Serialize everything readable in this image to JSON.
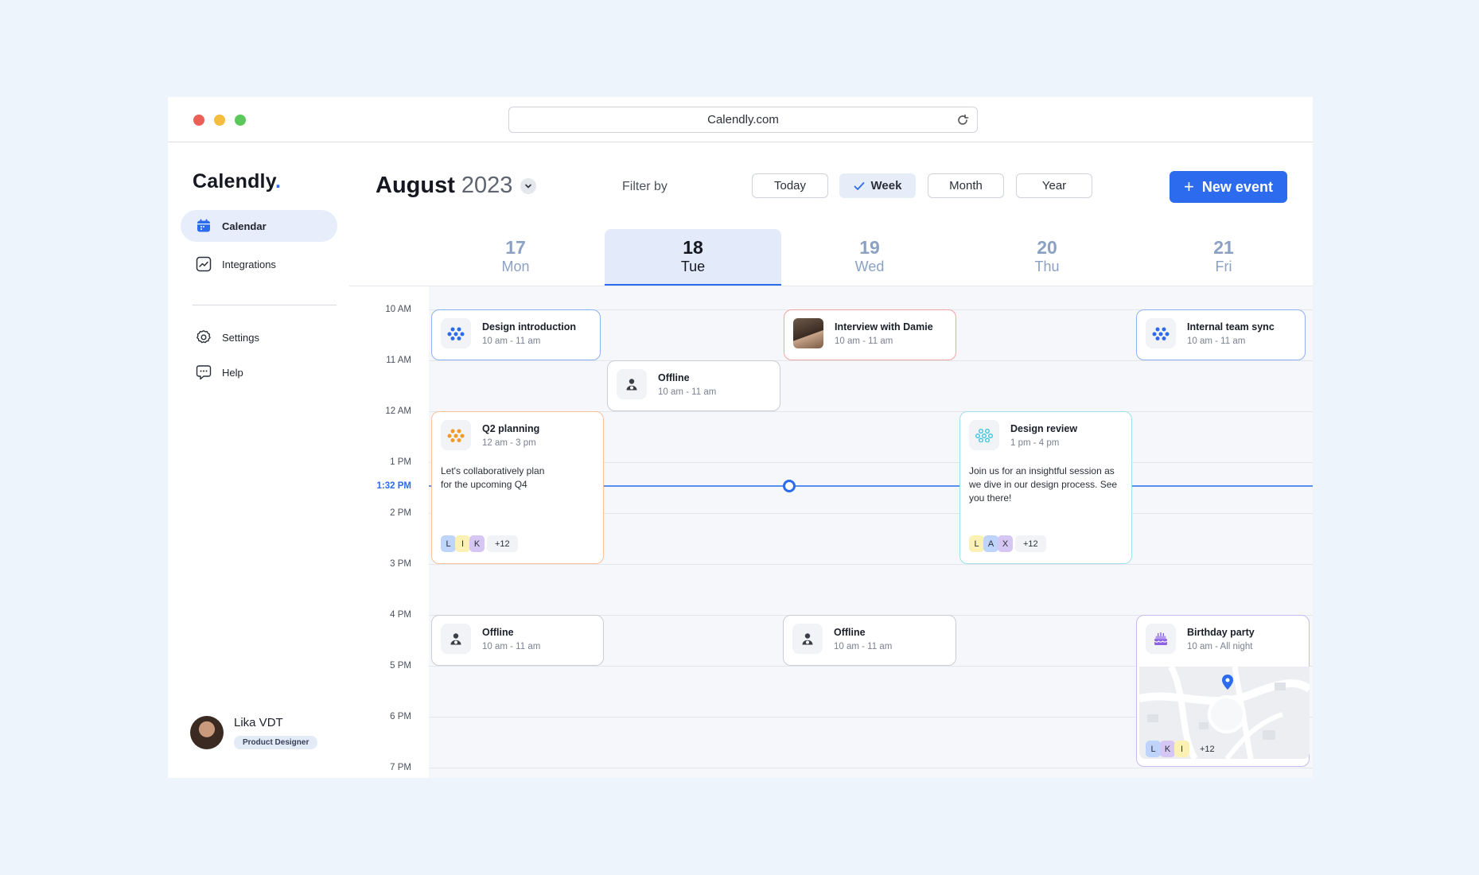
{
  "browser": {
    "url": "Calendly.com"
  },
  "app": {
    "logo_text": "Calendly",
    "logo_dot": ".",
    "accent": "#2c6bed"
  },
  "sidebar": {
    "items": [
      {
        "label": "Calendar",
        "icon": "calendar-icon",
        "active": true
      },
      {
        "label": "Integrations",
        "icon": "chart-icon",
        "active": false
      },
      {
        "label": "Settings",
        "icon": "gear-icon",
        "active": false
      },
      {
        "label": "Help",
        "icon": "chat-icon",
        "active": false
      }
    ],
    "profile": {
      "name": "Lika VDT",
      "role": "Product Designer"
    }
  },
  "header": {
    "month": "August",
    "year": "2023",
    "filter_label": "Filter by",
    "filters": [
      "Today",
      "Week",
      "Month",
      "Year"
    ],
    "active_filter": "Week",
    "new_event_label": "New event"
  },
  "days": [
    {
      "num": "17",
      "name": "Mon"
    },
    {
      "num": "18",
      "name": "Tue",
      "active": true
    },
    {
      "num": "19",
      "name": "Wed"
    },
    {
      "num": "20",
      "name": "Thu"
    },
    {
      "num": "21",
      "name": "Fri"
    }
  ],
  "times": [
    "10 AM",
    "11 AM",
    "12 AM",
    "1 PM",
    "2 PM",
    "3 PM",
    "4 PM",
    "5 PM",
    "6 PM",
    "7 PM"
  ],
  "now_label": "1:32 PM",
  "events": {
    "design_intro": {
      "title": "Design introduction",
      "time": "10 am - 11 am"
    },
    "interview": {
      "title": "Interview with Damie",
      "time": "10 am - 11 am"
    },
    "team_sync": {
      "title": "Internal team sync",
      "time": "10 am - 11 am"
    },
    "offline_tue": {
      "title": "Offline",
      "time": "10 am - 11 am"
    },
    "q2": {
      "title": "Q2 planning",
      "time": "12 am - 3 pm",
      "desc": "Let's collaboratively plan for the upcoming Q4",
      "chips": [
        "L",
        "I",
        "K"
      ],
      "more": "+12"
    },
    "review": {
      "title": "Design review",
      "time": "1 pm - 4 pm",
      "desc": "Join us for an insightful session as we dive in our design process. See you there!",
      "chips": [
        "L",
        "A",
        "X"
      ],
      "more": "+12"
    },
    "offline_mon": {
      "title": "Offline",
      "time": "10 am - 11 am"
    },
    "offline_wed": {
      "title": "Offline",
      "time": "10 am - 11 am"
    },
    "birthday": {
      "title": "Birthday party",
      "time": "10 am - All night",
      "chips": [
        "L",
        "K",
        "I"
      ],
      "more": "+12"
    }
  }
}
